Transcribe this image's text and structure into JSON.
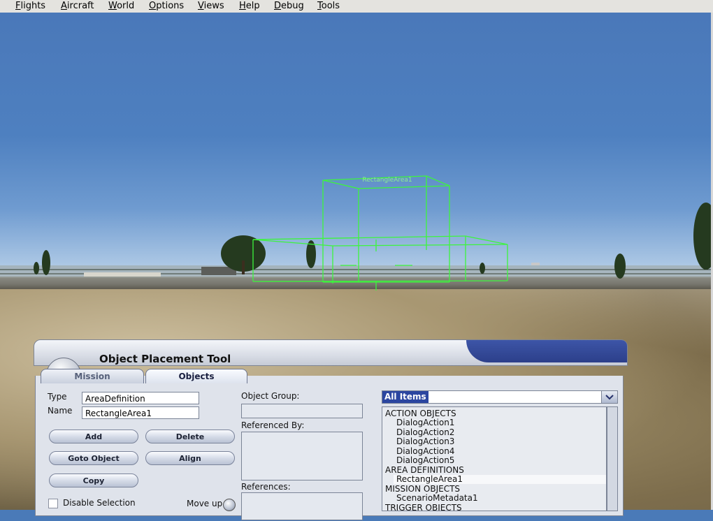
{
  "menu": [
    {
      "key": "F",
      "rest": "lights"
    },
    {
      "key": "A",
      "rest": "ircraft"
    },
    {
      "key": "W",
      "rest": "orld"
    },
    {
      "key": "O",
      "rest": "ptions"
    },
    {
      "key": "V",
      "rest": "iews"
    },
    {
      "key": "H",
      "rest": "elp"
    },
    {
      "key": "D",
      "rest": "ebug"
    },
    {
      "key": "T",
      "rest": "ools"
    }
  ],
  "scene": {
    "area_label": "RectangleArea1",
    "wireframe_color": "#3cf53c",
    "sky_color": "#4a78b9"
  },
  "dialog": {
    "title": "Object Placement Tool",
    "tabs": [
      "Mission",
      "Objects"
    ],
    "active_tab": "Objects",
    "type_label": "Type",
    "type_value": "AreaDefinition",
    "name_label": "Name",
    "name_value": "RectangleArea1",
    "buttons": {
      "add": "Add",
      "delete": "Delete",
      "goto": "Goto Object",
      "align": "Align",
      "copy": "Copy"
    },
    "disable_selection": "Disable Selection",
    "move_up": "Move up",
    "object_group_label": "Object Group:",
    "referenced_by_label": "Referenced By:",
    "references_label": "References:",
    "filter_value": "All Items",
    "tree": [
      {
        "text": "ACTION OBJECTS",
        "indent": 0
      },
      {
        "text": "DialogAction1",
        "indent": 1
      },
      {
        "text": "DialogAction2",
        "indent": 1
      },
      {
        "text": "DialogAction3",
        "indent": 1
      },
      {
        "text": "DialogAction4",
        "indent": 1
      },
      {
        "text": "DialogAction5",
        "indent": 1
      },
      {
        "text": "AREA DEFINITIONS",
        "indent": 0
      },
      {
        "text": "RectangleArea1",
        "indent": 1,
        "selected": true
      },
      {
        "text": "MISSION OBJECTS",
        "indent": 0
      },
      {
        "text": "ScenarioMetadata1",
        "indent": 1
      },
      {
        "text": "TRIGGER OBJECTS",
        "indent": 0
      }
    ]
  }
}
